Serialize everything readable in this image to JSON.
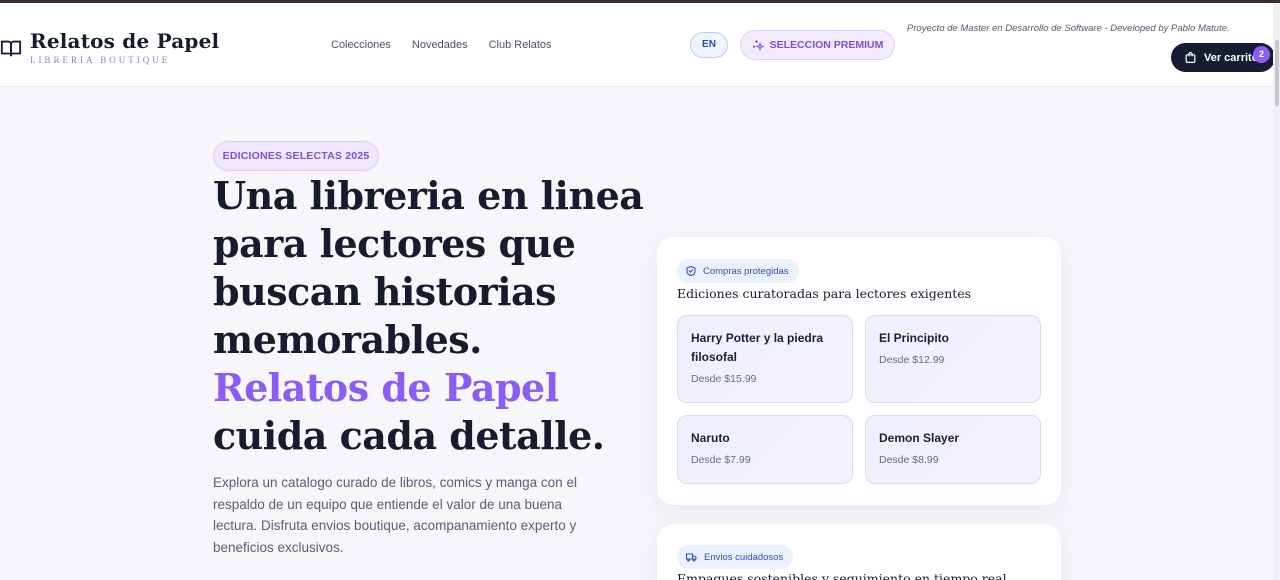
{
  "header": {
    "brand_title": "Relatos de Papel",
    "brand_subtitle": "LIBRERIA BOUTIQUE",
    "nav": [
      "Colecciones",
      "Novedades",
      "Club Relatos"
    ],
    "lang_label": "EN",
    "premium_label": "SELECCION PREMIUM",
    "dev_note": "Proyecto de Master en Desarrollo de Software - Developed by Pablo Matute.",
    "cart_label": "Ver carrito",
    "cart_count": "2"
  },
  "hero": {
    "badge": "EDICIONES SELECTAS 2025",
    "title_lines": [
      "Una libreria en linea",
      "para lectores que",
      "buscan historias",
      "memorables."
    ],
    "title_accent": "Relatos de Papel",
    "title_end": "cuida cada detalle.",
    "lead": "Explora un catalogo curado de libros, comics y manga con el respaldo de un equipo que entiende el valor de una buena lectura. Disfruta envios boutique, acompanamiento experto y beneficios exclusivos."
  },
  "showcase": {
    "pill": "Compras protegidas",
    "title": "Ediciones curatoradas para lectores exigentes",
    "books": [
      {
        "title": "Harry Potter y la piedra filosofal",
        "price": "Desde $15.99"
      },
      {
        "title": "El Principito",
        "price": "Desde $12.99"
      },
      {
        "title": "Naruto",
        "price": "Desde $7.99"
      },
      {
        "title": "Demon Slayer",
        "price": "Desde $8.99"
      }
    ]
  },
  "shipping": {
    "pill": "Envios cuidadosos",
    "title": "Empaques sostenibles y seguimiento en tiempo real"
  },
  "colors": {
    "accent": "#8b5cf6",
    "dark": "#161b2e",
    "info_blue": "#2b53b8"
  }
}
